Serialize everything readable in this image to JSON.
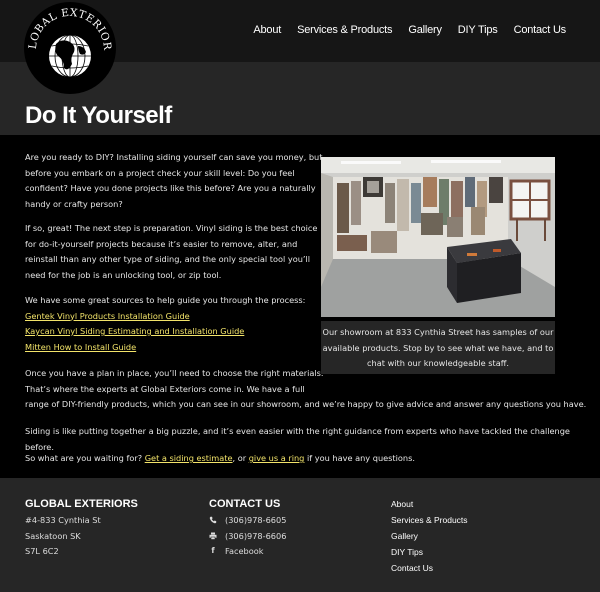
{
  "header": {
    "logo_text": "GLOBAL EXTERIORS",
    "nav": [
      "About",
      "Services & Products",
      "Gallery",
      "DIY Tips",
      "Contact Us"
    ]
  },
  "page_title": "Do It Yourself",
  "content": {
    "para1": [
      "Are you ready to DIY? Installing siding yourself can save you money, but",
      "before you embark on a project check your skill level: Do you feel",
      "confident? Have you done projects like this before? Are you a naturally",
      "handy or crafty person?"
    ],
    "para2": [
      "If so, great! The next step is preparation. Vinyl siding is the best choice",
      "for do-it-yourself projects because it’s easier to remove, alter, and",
      "reinstall than any other type of siding, and the only special tool you’ll",
      "need for the job is an unlocking tool, or zip tool."
    ],
    "para3_intro": "We have some great sources to help guide you through the process:",
    "guides": [
      "Gentek Vinyl Products Installation Guide",
      "Kaycan Vinyl Siding Estimating and Installation Guide",
      "Mitten How to Install Guide"
    ],
    "para4": [
      "Once you have a plan in place, you’ll need to choose the right materials.",
      "That’s where the experts at Global Exteriors come in. We have a full",
      "range of DIY-friendly products, which you can see in our showroom, and we’re happy to give advice and answer any questions you have."
    ],
    "para5": "Siding is like putting together a big puzzle, and it’s even easier with the right guidance from experts who have tackled the challenge before.",
    "para6": {
      "before": "So what are you waiting for? ",
      "link1": "Get a siding estimate",
      "middle": ", or ",
      "link2": "give us a ring",
      "after": " if you have any questions."
    },
    "caption": [
      "Our showroom at 833 Cynthia Street has samples of our",
      "available products. Stop by to see what we have, and to",
      "chat with our knowledgeable staff."
    ]
  },
  "footer": {
    "company": {
      "title": "GLOBAL EXTERIORS",
      "address": [
        "#4-833 Cynthia St",
        "Saskatoon SK",
        "S7L 6C2"
      ]
    },
    "contact": {
      "title": "CONTACT US",
      "phone": "(306)978-6605",
      "fax": "(306)978-6606",
      "facebook": "Facebook"
    },
    "links": [
      "About",
      "Services & Products",
      "Gallery",
      "DIY Tips",
      "Contact Us"
    ]
  },
  "icons": {
    "phone": "phone-icon",
    "fax": "printer-icon",
    "facebook": "facebook-icon"
  },
  "colors": {
    "link": "#f3e46a",
    "header_bg": "#161616",
    "band_bg": "#262626",
    "body_bg": "#000000"
  }
}
